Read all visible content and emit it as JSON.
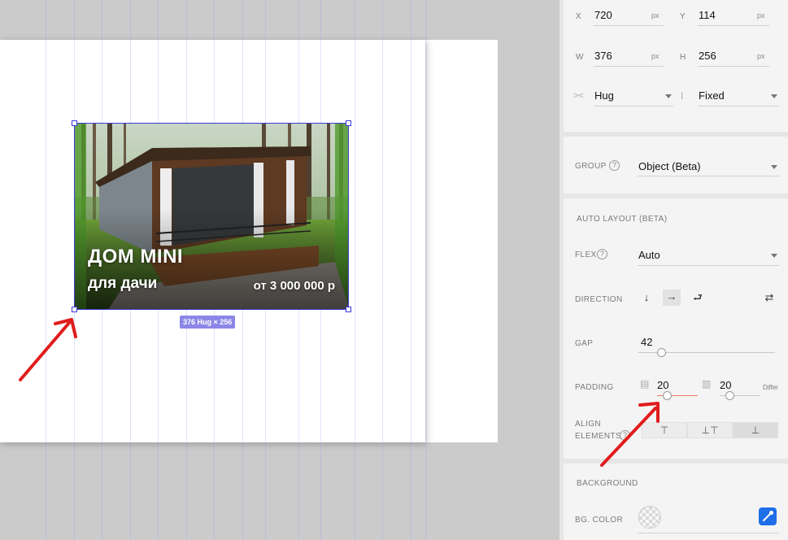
{
  "canvas": {
    "banner": {
      "title": "ДОМ MINI",
      "subtitle": "для дачи",
      "price": "от 3 000 000 р"
    },
    "size_tag": "376 Hug × 256"
  },
  "panel": {
    "x": {
      "label": "X",
      "value": "720",
      "unit": "px"
    },
    "y": {
      "label": "Y",
      "value": "114",
      "unit": "px"
    },
    "w": {
      "label": "W",
      "value": "376",
      "unit": "px"
    },
    "h": {
      "label": "H",
      "value": "256",
      "unit": "px"
    },
    "w_mode": "Hug",
    "h_mode": "Fixed",
    "group": {
      "label": "GROUP",
      "value": "Object (Beta)"
    },
    "auto_layout": {
      "title": "AUTO LAYOUT (BETA)",
      "flex_label": "FLEX",
      "flex_value": "Auto",
      "direction_label": "DIRECTION",
      "gap_label": "GAP",
      "gap_value": "42",
      "padding_label": "PADDING",
      "padding_v": "20",
      "padding_h": "20",
      "padding_mode": "Differ",
      "align_label_1": "ALIGN",
      "align_label_2": "ELEMENTS"
    },
    "background": {
      "title": "BACKGROUND",
      "color_label": "BG. COLOR"
    }
  },
  "colors": {
    "selection": "#3b3bd6",
    "size_tag": "#8c87e6",
    "annotation_arrow": "#e11c1c",
    "picker_accent": "#1e6fe8"
  }
}
